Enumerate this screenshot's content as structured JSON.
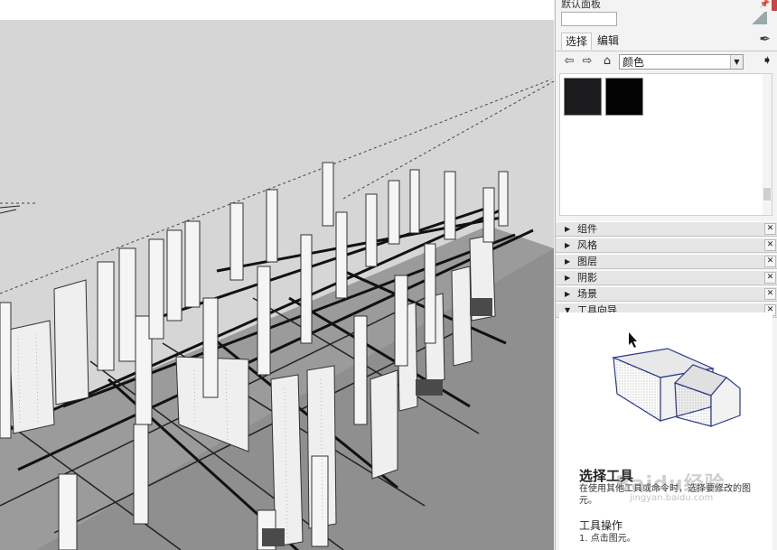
{
  "panel": {
    "title": "默认面板",
    "tabs": [
      {
        "label": "选择",
        "active": true
      },
      {
        "label": "编辑",
        "active": false
      }
    ],
    "material_library": "颜色",
    "swatch_colors": [
      "#1b1b1d",
      "#030303"
    ]
  },
  "trays": [
    {
      "label": "组件",
      "expanded": false
    },
    {
      "label": "风格",
      "expanded": false
    },
    {
      "label": "图层",
      "expanded": false
    },
    {
      "label": "阴影",
      "expanded": false
    },
    {
      "label": "场景",
      "expanded": false
    },
    {
      "label": "工具向导",
      "expanded": true
    }
  ],
  "instructor": {
    "title": "选择工具",
    "description": "在使用其他工具或命令时，选择要修改的图元。",
    "operation_heading": "工具操作",
    "step": "1. 点击图元。"
  },
  "watermark": {
    "logo": "Baidu经验",
    "url": "jingyan.baidu.com"
  },
  "colors": {
    "viewport_bg": "#d6d6d6",
    "ground": "#8e8e8e",
    "accent_outline": "#2b3a8a"
  }
}
